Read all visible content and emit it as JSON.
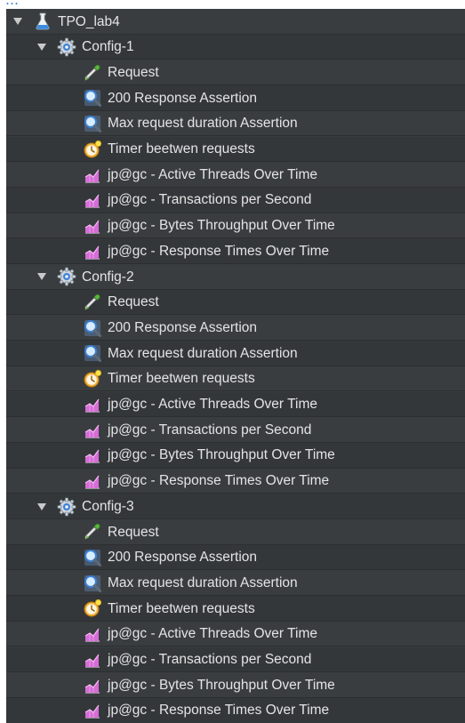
{
  "page_header_fragment": "…",
  "tree": {
    "root": {
      "label": "TPO_lab4",
      "icon": "flask-icon",
      "expanded": true
    },
    "groups": [
      {
        "label": "Config-1",
        "icon": "gear-icon",
        "expanded": true,
        "children": [
          {
            "label": "Request",
            "icon": "pipette-icon"
          },
          {
            "label": "200 Response Assertion",
            "icon": "magnifier-icon"
          },
          {
            "label": "Max request duration Assertion",
            "icon": "magnifier-icon"
          },
          {
            "label": "Timer beetwen requests",
            "icon": "timer-icon"
          },
          {
            "label": "jp@gc - Active Threads Over Time",
            "icon": "graph-listener-icon"
          },
          {
            "label": "jp@gc - Transactions per Second",
            "icon": "graph-listener-icon"
          },
          {
            "label": "jp@gc - Bytes Throughput Over Time",
            "icon": "graph-listener-icon"
          },
          {
            "label": "jp@gc - Response Times Over Time",
            "icon": "graph-listener-icon"
          }
        ]
      },
      {
        "label": "Config-2",
        "icon": "gear-icon",
        "expanded": true,
        "children": [
          {
            "label": "Request",
            "icon": "pipette-icon"
          },
          {
            "label": "200 Response Assertion",
            "icon": "magnifier-icon"
          },
          {
            "label": "Max request duration Assertion",
            "icon": "magnifier-icon"
          },
          {
            "label": "Timer beetwen requests",
            "icon": "timer-icon"
          },
          {
            "label": "jp@gc - Active Threads Over Time",
            "icon": "graph-listener-icon"
          },
          {
            "label": "jp@gc - Transactions per Second",
            "icon": "graph-listener-icon"
          },
          {
            "label": "jp@gc - Bytes Throughput Over Time",
            "icon": "graph-listener-icon"
          },
          {
            "label": "jp@gc - Response Times Over Time",
            "icon": "graph-listener-icon"
          }
        ]
      },
      {
        "label": "Config-3",
        "icon": "gear-icon",
        "expanded": true,
        "children": [
          {
            "label": "Request",
            "icon": "pipette-icon"
          },
          {
            "label": "200 Response Assertion",
            "icon": "magnifier-icon"
          },
          {
            "label": "Max request duration Assertion",
            "icon": "magnifier-icon"
          },
          {
            "label": "Timer beetwen requests",
            "icon": "timer-icon"
          },
          {
            "label": "jp@gc - Active Threads Over Time",
            "icon": "graph-listener-icon"
          },
          {
            "label": "jp@gc - Transactions per Second",
            "icon": "graph-listener-icon"
          },
          {
            "label": "jp@gc - Bytes Throughput Over Time",
            "icon": "graph-listener-icon"
          },
          {
            "label": "jp@gc - Response Times Over Time",
            "icon": "graph-listener-icon"
          }
        ]
      }
    ]
  },
  "colors": {
    "background": "#3a3d40",
    "row_alt": "#34373a",
    "text": "#e4e4e4",
    "header_fragment": "#2f7fd0"
  }
}
